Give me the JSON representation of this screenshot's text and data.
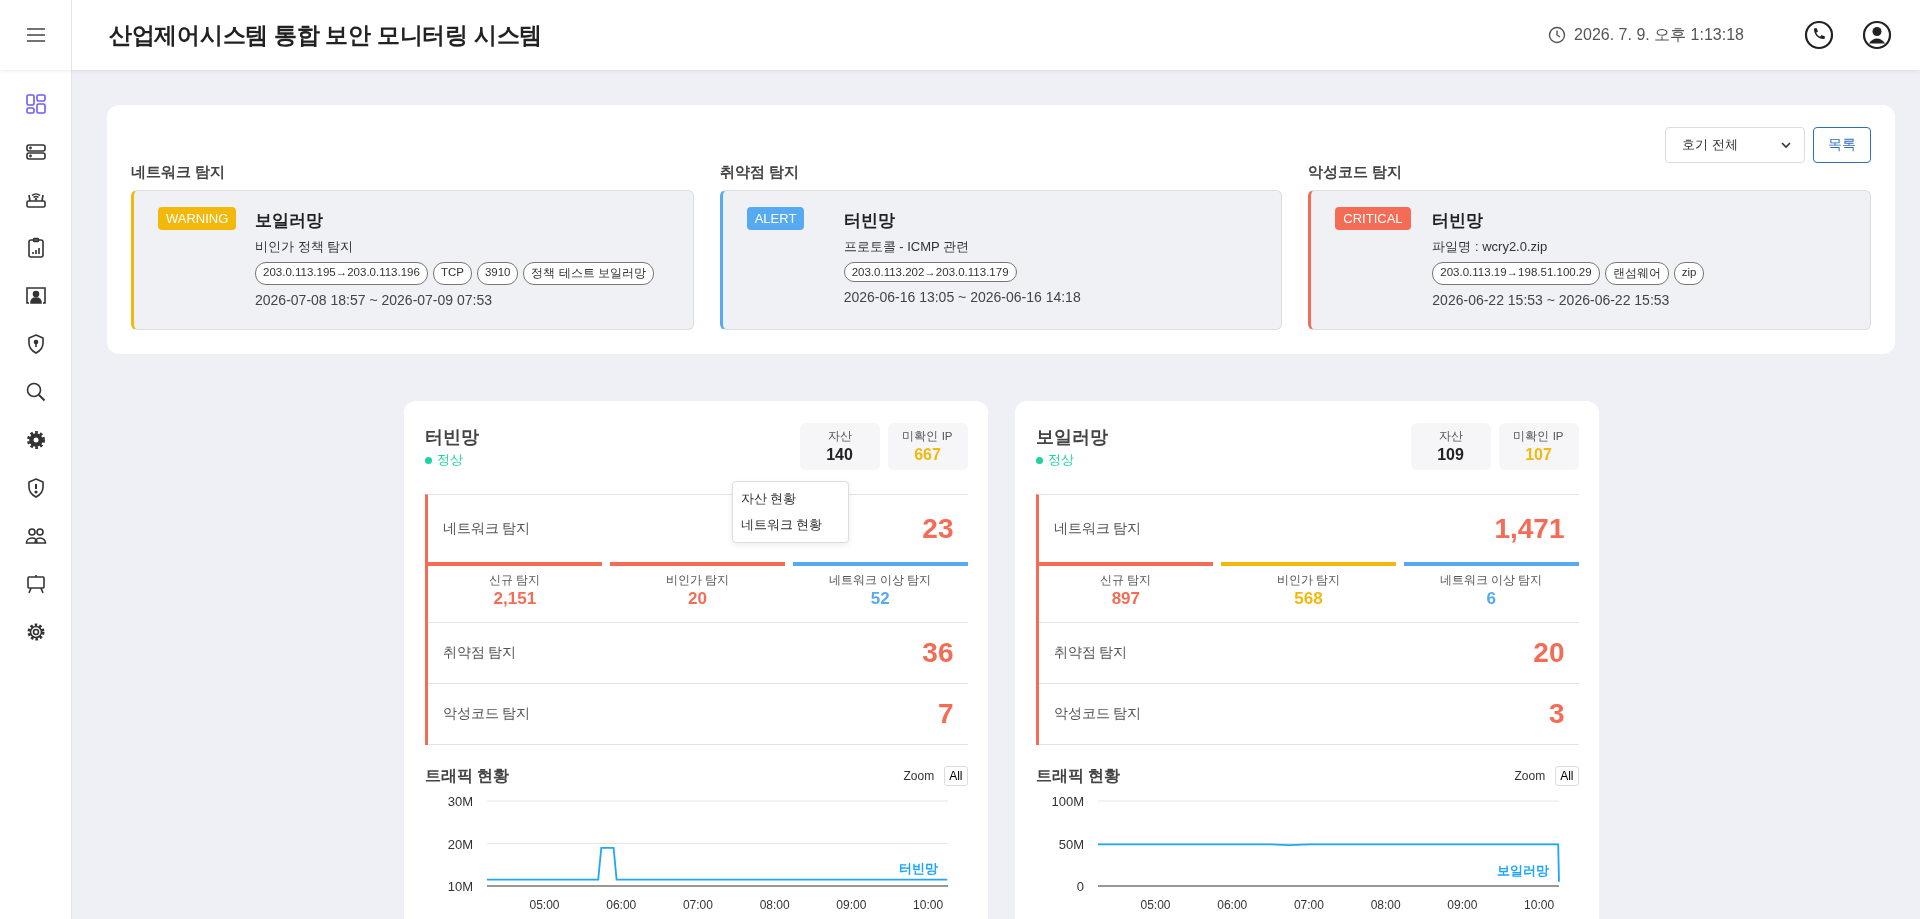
{
  "header": {
    "title": "산업제어시스템 통합 보안 모니터링 시스템",
    "datetime": "2026. 7. 9. 오후 1:13:18"
  },
  "sidebar": {
    "items": [
      {
        "selected": true
      },
      {
        "selected": false
      },
      {
        "selected": false
      },
      {
        "selected": false
      },
      {
        "selected": false
      },
      {
        "selected": false
      },
      {
        "selected": false
      },
      {
        "selected": false
      },
      {
        "selected": false
      },
      {
        "selected": false
      },
      {
        "selected": false
      },
      {
        "selected": false
      }
    ]
  },
  "detection_panel": {
    "filter": {
      "value": "호기 전체"
    },
    "list_button": "목록",
    "sections": [
      {
        "heading": "네트워크 탐지",
        "kind": "warning",
        "severity": "WARNING",
        "network": "보일러망",
        "description": "비인가 정책 탐지",
        "tags": [
          "203.0.113.195→203.0.113.196",
          "TCP",
          "3910",
          "정책 테스트 보일러망"
        ],
        "period": "2026-07-08 18:57 ~ 2026-07-09 07:53"
      },
      {
        "heading": "취약점 탐지",
        "kind": "alert",
        "severity": "ALERT",
        "network": "터빈망",
        "description": "프로토콜 - ICMP 관련",
        "tags": [
          "203.0.113.202→203.0.113.179"
        ],
        "period": "2026-06-16 13:05 ~ 2026-06-16 14:18"
      },
      {
        "heading": "악성코드 탐지",
        "kind": "critical",
        "severity": "CRITICAL",
        "network": "터빈망",
        "description": "파일명 : wcry2.0.zip",
        "tags": [
          "203.0.113.19→198.51.100.29",
          "랜섬웨어",
          "zip"
        ],
        "period": "2026-06-22 15:53 ~ 2026-06-22 15:53"
      }
    ]
  },
  "networks": [
    {
      "name": "터빈망",
      "status": "정상",
      "assets_label": "자산",
      "assets": "140",
      "unconfirmed_label": "미확인 IP",
      "unconfirmed": "667",
      "menu": {
        "items": [
          "자산 현황",
          "네트워크 현황"
        ]
      },
      "network_detection": {
        "label": "네트워크 탐지",
        "value": "23",
        "breakdown": [
          {
            "label": "신규 탐지",
            "value": "2,151",
            "color": "#f46c55"
          },
          {
            "label": "비인가 탐지",
            "value": "20",
            "color": "#f46c55"
          },
          {
            "label": "네트워크 이상 탐지",
            "value": "52",
            "color": "#56aaf2"
          }
        ]
      },
      "vulnerability": {
        "label": "취약점 탐지",
        "value": "36"
      },
      "malware": {
        "label": "악성코드 탐지",
        "value": "7"
      },
      "traffic": {
        "title": "트래픽 현황",
        "zoom_label": "Zoom",
        "zoom_button": "All",
        "chart_data": {
          "type": "line",
          "x": [
            4.25,
            4.5,
            4.75,
            5,
            5.25,
            5.5,
            5.7,
            5.74,
            5.9,
            5.94,
            6.25,
            6.5,
            6.75,
            7,
            7.25,
            7.5,
            7.75,
            8,
            8.25,
            8.5,
            8.75,
            9,
            9.25,
            9.5,
            9.75,
            10,
            10.25
          ],
          "series": [
            {
              "name": "터빈망",
              "color": "#1ea7f5",
              "values": [
                11.5,
                11.5,
                11.5,
                11.5,
                11.5,
                11.5,
                11.5,
                19,
                19,
                11.5,
                11.5,
                11.5,
                11.5,
                11.5,
                11.5,
                11.5,
                11.5,
                11.5,
                11.5,
                11.5,
                11.5,
                11.5,
                11.5,
                11.5,
                11.5,
                11.5,
                11.5
              ]
            }
          ],
          "xlim": [
            4.25,
            10.26
          ],
          "ylim": [
            10,
            30
          ],
          "xticks": [
            {
              "value": 5,
              "label": "05:00"
            },
            {
              "value": 6,
              "label": "06:00"
            },
            {
              "value": 7,
              "label": "07:00"
            },
            {
              "value": 8,
              "label": "08:00"
            },
            {
              "value": 9,
              "label": "09:00"
            },
            {
              "value": 10,
              "label": "10:00"
            }
          ],
          "yticks": [
            {
              "value": 10,
              "label": "10M"
            },
            {
              "value": 20,
              "label": "20M"
            },
            {
              "value": 30,
              "label": "30M"
            }
          ]
        }
      }
    },
    {
      "name": "보일러망",
      "status": "정상",
      "assets_label": "자산",
      "assets": "109",
      "unconfirmed_label": "미확인 IP",
      "unconfirmed": "107",
      "network_detection": {
        "label": "네트워크 탐지",
        "value": "1,471",
        "breakdown": [
          {
            "label": "신규 탐지",
            "value": "897",
            "color": "#f46c55"
          },
          {
            "label": "비인가 탐지",
            "value": "568",
            "color": "#f2b90c"
          },
          {
            "label": "네트워크 이상 탐지",
            "value": "6",
            "color": "#56aaf2"
          }
        ]
      },
      "vulnerability": {
        "label": "취약점 탐지",
        "value": "20"
      },
      "malware": {
        "label": "악성코드 탐지",
        "value": "3"
      },
      "traffic": {
        "title": "트래픽 현황",
        "zoom_label": "Zoom",
        "zoom_button": "All",
        "chart_data": {
          "type": "line",
          "x": [
            4.25,
            4.5,
            4.75,
            5,
            5.25,
            5.5,
            5.75,
            6,
            6.25,
            6.5,
            6.75,
            7,
            7.25,
            7.5,
            7.75,
            8,
            8.25,
            8.5,
            8.75,
            9,
            9.25,
            9.5,
            9.75,
            10,
            10.25,
            10.26
          ],
          "series": [
            {
              "name": "보일러망",
              "color": "#1ea7f5",
              "values": [
                49,
                49,
                49,
                49,
                49,
                49,
                49,
                49,
                49,
                49,
                48,
                49,
                49,
                49,
                49,
                49,
                49,
                49,
                49,
                49,
                49,
                49,
                49,
                49,
                49,
                5
              ]
            }
          ],
          "xlim": [
            4.25,
            10.26
          ],
          "ylim": [
            0,
            100
          ],
          "xticks": [
            {
              "value": 5,
              "label": "05:00"
            },
            {
              "value": 6,
              "label": "06:00"
            },
            {
              "value": 7,
              "label": "07:00"
            },
            {
              "value": 8,
              "label": "08:00"
            },
            {
              "value": 9,
              "label": "09:00"
            },
            {
              "value": 10,
              "label": "10:00"
            }
          ],
          "yticks": [
            {
              "value": 0,
              "label": "0"
            },
            {
              "value": 50,
              "label": "50M"
            },
            {
              "value": 100,
              "label": "100M"
            }
          ]
        }
      }
    }
  ]
}
